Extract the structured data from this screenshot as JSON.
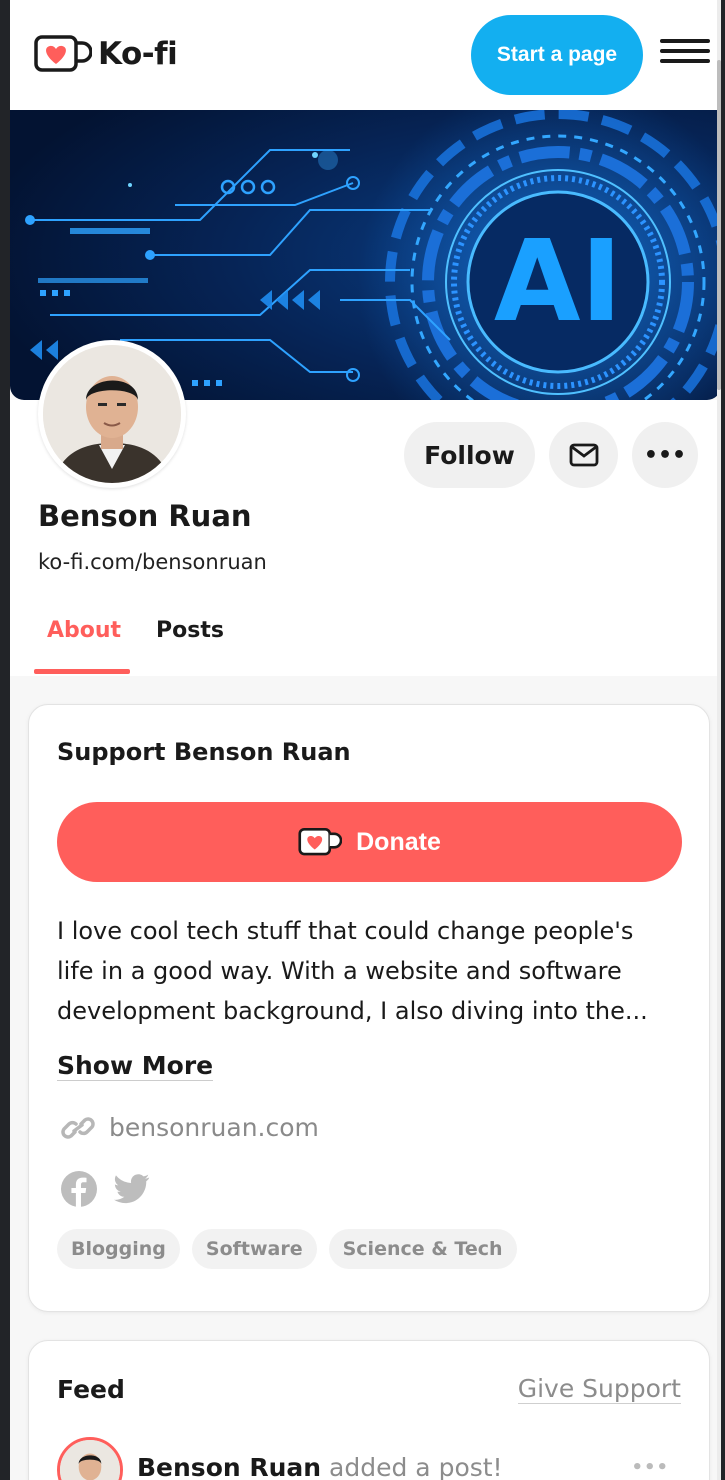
{
  "header": {
    "logo_text": "Ko-fi",
    "start_button": "Start a page"
  },
  "banner": {
    "text": "AI"
  },
  "profile": {
    "name": "Benson Ruan",
    "url": "ko-fi.com/bensonruan",
    "follow_label": "Follow",
    "more_label": "•••"
  },
  "tabs": [
    {
      "label": "About",
      "active": true
    },
    {
      "label": "Posts",
      "active": false
    }
  ],
  "support": {
    "title": "Support Benson Ruan",
    "donate_label": "Donate",
    "bio_lines": [
      "I love cool tech stuff that could change people's",
      "life in a good way. With a website and software",
      "development background, I also diving into the..."
    ],
    "show_more": "Show More",
    "website": "bensonruan.com",
    "socials": [
      "facebook-icon",
      "twitter-icon"
    ],
    "tags": [
      "Blogging",
      "Software",
      "Science & Tech"
    ]
  },
  "feed": {
    "title": "Feed",
    "give_support": "Give Support",
    "item": {
      "name": "Benson Ruan",
      "action": "added a post!",
      "more": "•••"
    }
  },
  "colors": {
    "brand_blue": "#13aff0",
    "brand_red": "#ff5e5b"
  }
}
